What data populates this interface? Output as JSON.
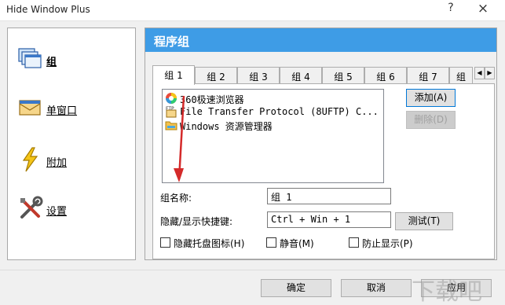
{
  "window": {
    "title": "Hide Window Plus",
    "help_glyph": "?",
    "close_glyph": "×"
  },
  "sidebar": {
    "items": [
      {
        "label": "组",
        "icon": "windows-stack-icon",
        "active": true
      },
      {
        "label": "单窗口",
        "icon": "single-window-icon",
        "active": false
      },
      {
        "label": "附加",
        "icon": "lightning-icon",
        "active": false
      },
      {
        "label": "设置",
        "icon": "tools-icon",
        "active": false
      }
    ]
  },
  "panel": {
    "title": "程序组",
    "tabs": [
      "组 1",
      "组 2",
      "组 3",
      "组 4",
      "组 5",
      "组 6",
      "组 7",
      "组"
    ],
    "active_tab": 0,
    "programs": [
      {
        "name": "360极速浏览器",
        "icon": "browser-360-icon"
      },
      {
        "name": "File Transfer Protocol (8UFTP) C...",
        "icon": "ftp-icon"
      },
      {
        "name": "Windows 资源管理器",
        "icon": "explorer-folder-icon"
      }
    ],
    "add_button": "添加(A)",
    "delete_button": "删除(D)",
    "group_name_label": "组名称:",
    "group_name_value": "组 1",
    "hotkey_label": "隐藏/显示快捷键:",
    "hotkey_value": "Ctrl + Win + 1",
    "test_button": "测试(T)",
    "checkboxes": [
      {
        "label": "隐藏托盘图标(H)",
        "checked": false
      },
      {
        "label": "静音(M)",
        "checked": false
      },
      {
        "label": "防止显示(P)",
        "checked": false
      }
    ]
  },
  "footer": {
    "ok": "确定",
    "cancel": "取消",
    "apply": "应用"
  },
  "colors": {
    "header_blue": "#3e9ce6",
    "annotation_arrow": "#d42a2a"
  }
}
